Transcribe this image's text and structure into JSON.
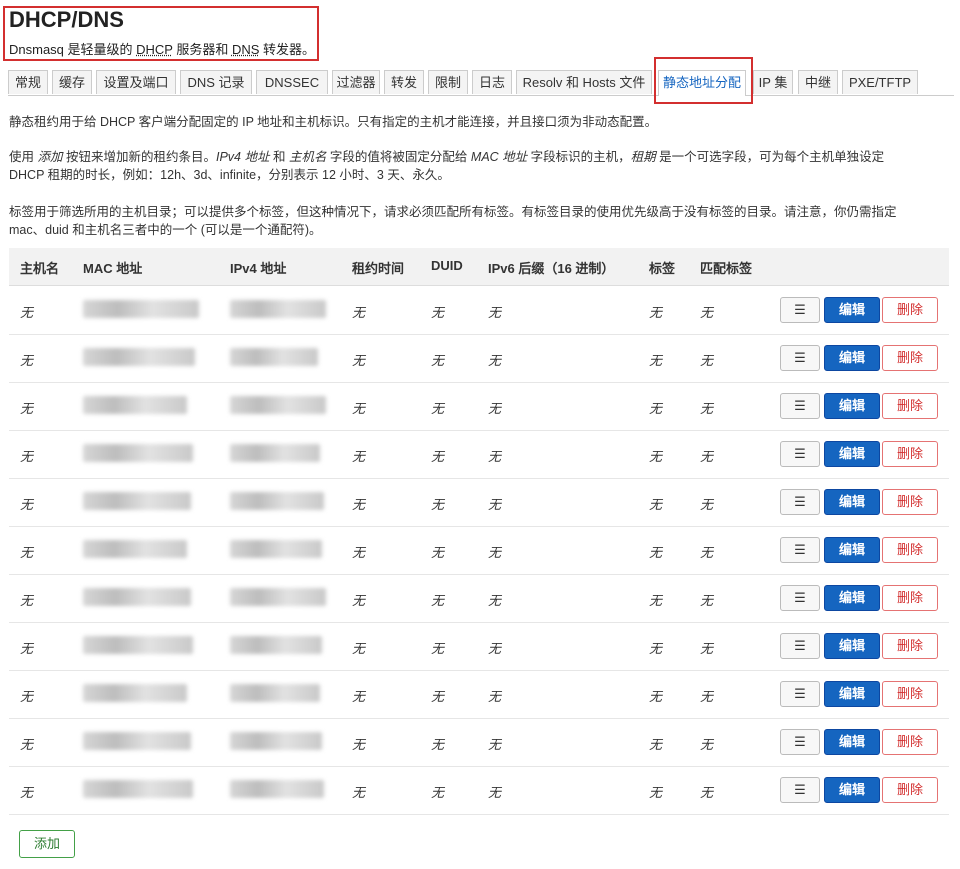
{
  "header": {
    "title": "DHCP/DNS",
    "subtitle_pre": "Dnsmasq 是轻量级的 ",
    "subtitle_dhcp": "DHCP",
    "subtitle_mid": " 服务器和 ",
    "subtitle_dns": "DNS",
    "subtitle_post": " 转发器。"
  },
  "tabs": [
    "常规",
    "缓存",
    "设置及端口",
    "DNS 记录",
    "DNSSEC",
    "过滤器",
    "转发",
    "限制",
    "日志",
    "Resolv 和 Hosts 文件",
    "静态地址分配",
    "IP 集",
    "中继",
    "PXE/TFTP"
  ],
  "active_tab": "静态地址分配",
  "description": {
    "p1": "静态租约用于给 DHCP 客户端分配固定的 IP 地址和主机标识。只有指定的主机才能连接，并且接口须为非动态配置。",
    "p2a": "使用 ",
    "p2_add": "添加",
    "p2b": " 按钮来增加新的租约条目。",
    "p2_ipv4": "IPv4 地址",
    "p2c": " 和 ",
    "p2_host": "主机名",
    "p2d": " 字段的值将被固定分配给 ",
    "p2_mac": "MAC 地址",
    "p2e": " 字段标识的主机，",
    "p2_lease": "租期",
    "p2f": " 是一个可选字段，可为每个主机单独设定",
    "p2g": "DHCP 租期的时长，例如：12h、3d、infinite，分别表示 12 小时、3 天、永久。",
    "p3a": "标签用于筛选所用的主机目录；可以提供多个标签，但这种情况下，请求必须匹配所有标签。有标签目录的使用优先级高于没有标签的目录。请注意，你仍需指定",
    "p3b": "mac、duid 和主机名三者中的一个 (可以是一个通配符)。"
  },
  "table": {
    "columns": [
      "主机名",
      "MAC 地址",
      "IPv4 地址",
      "租约时间",
      "DUID",
      "IPv6 后缀（16 进制）",
      "标签",
      "匹配标签"
    ],
    "rows": [
      {
        "hostname": "无",
        "lease": "无",
        "duid": "无",
        "ipv6": "无",
        "tag": "无",
        "match": "无"
      },
      {
        "hostname": "无",
        "lease": "无",
        "duid": "无",
        "ipv6": "无",
        "tag": "无",
        "match": "无"
      },
      {
        "hostname": "无",
        "lease": "无",
        "duid": "无",
        "ipv6": "无",
        "tag": "无",
        "match": "无"
      },
      {
        "hostname": "无",
        "lease": "无",
        "duid": "无",
        "ipv6": "无",
        "tag": "无",
        "match": "无"
      },
      {
        "hostname": "无",
        "lease": "无",
        "duid": "无",
        "ipv6": "无",
        "tag": "无",
        "match": "无"
      },
      {
        "hostname": "无",
        "lease": "无",
        "duid": "无",
        "ipv6": "无",
        "tag": "无",
        "match": "无"
      },
      {
        "hostname": "无",
        "lease": "无",
        "duid": "无",
        "ipv6": "无",
        "tag": "无",
        "match": "无"
      },
      {
        "hostname": "无",
        "lease": "无",
        "duid": "无",
        "ipv6": "无",
        "tag": "无",
        "match": "无"
      },
      {
        "hostname": "无",
        "lease": "无",
        "duid": "无",
        "ipv6": "无",
        "tag": "无",
        "match": "无"
      },
      {
        "hostname": "无",
        "lease": "无",
        "duid": "无",
        "ipv6": "无",
        "tag": "无",
        "match": "无"
      },
      {
        "hostname": "无",
        "lease": "无",
        "duid": "无",
        "ipv6": "无",
        "tag": "无",
        "match": "无"
      }
    ],
    "more_label": "☰",
    "edit_label": "编辑",
    "delete_label": "删除"
  },
  "add_button": "添加",
  "colors": {
    "accent": "#1565c0",
    "danger": "#d32f2f",
    "success": "#2e7d32",
    "highlight": "#d32f2f"
  }
}
